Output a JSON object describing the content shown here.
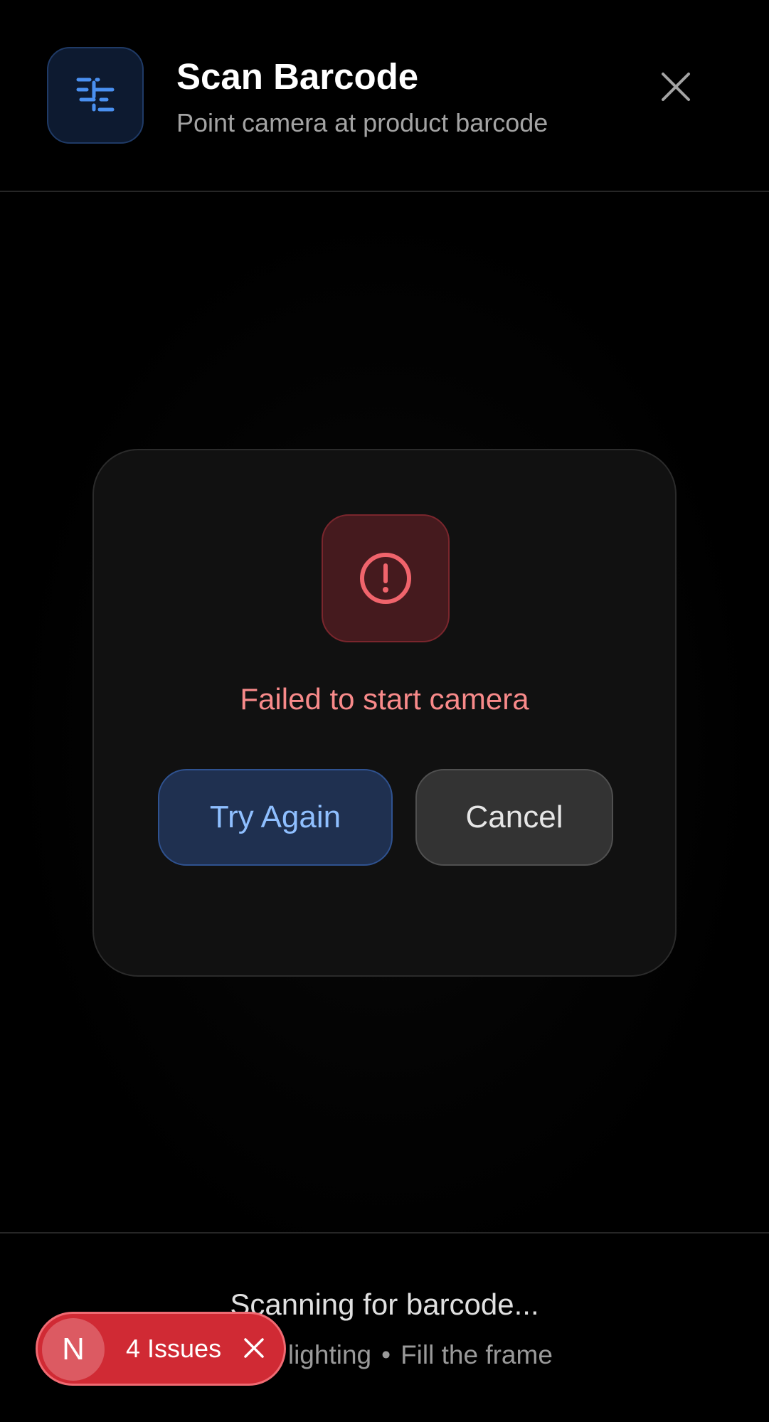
{
  "header": {
    "title": "Scan Barcode",
    "subtitle": "Point camera at product barcode",
    "app_icon": "barcode-scan-icon",
    "close_icon": "close-icon"
  },
  "error": {
    "icon": "alert-circle-icon",
    "message": "Failed to start camera",
    "retry_label": "Try Again",
    "cancel_label": "Cancel"
  },
  "footer": {
    "status": "Scanning for barcode...",
    "tips": [
      "Good lighting",
      "Fill the frame"
    ],
    "tip_separator": "•"
  },
  "issues_badge": {
    "letter": "N",
    "label": "4 Issues",
    "close_icon": "close-icon"
  },
  "colors": {
    "background": "#000000",
    "accent_blue": "#4a90f0",
    "error_red": "#f0646c",
    "error_text": "#f88a8a",
    "issues_red": "#d02a34"
  }
}
